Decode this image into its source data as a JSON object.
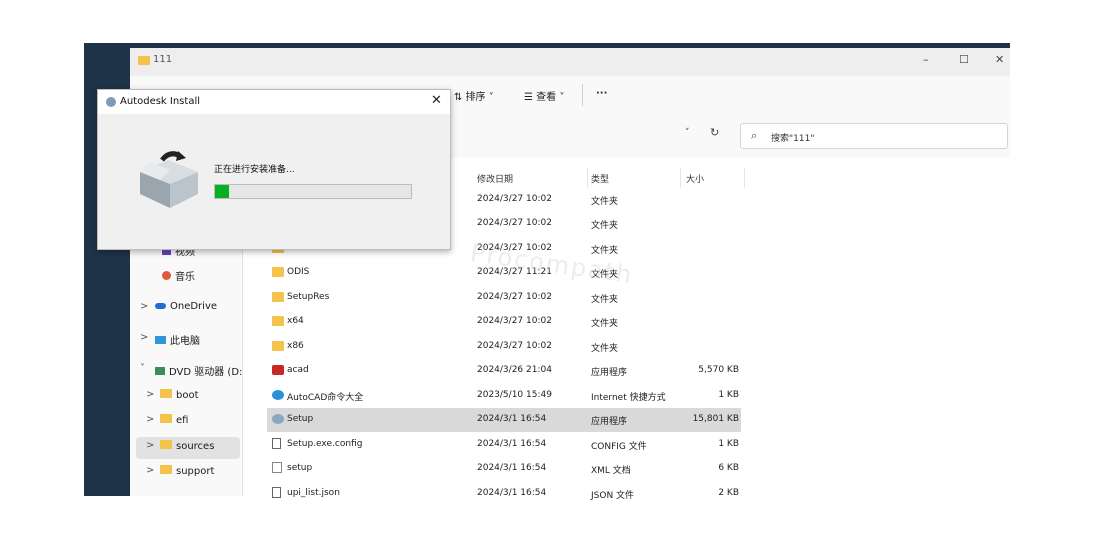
{
  "explorer": {
    "title": "111",
    "window_buttons": {
      "minimize": "–",
      "maximize": "☐",
      "close": "✕"
    },
    "toolbar": {
      "sort_label": "⇅ 排序 ˅",
      "view_label": "☰ 查看 ˅",
      "more_label": "···"
    },
    "address": {
      "chevron": "˅",
      "refresh": "↻"
    },
    "search": {
      "placeholder": "搜索\"111\""
    }
  },
  "sidebar": {
    "items": [
      {
        "label": "视频"
      },
      {
        "label": "音乐"
      },
      {
        "label": "OneDrive",
        "chevron": ">"
      },
      {
        "label": "此电脑",
        "chevron": ">"
      },
      {
        "label": "DVD 驱动器 (D:",
        "chevron": "˅"
      },
      {
        "label": "boot",
        "chevron": ">"
      },
      {
        "label": "efi",
        "chevron": ">"
      },
      {
        "label": "sources",
        "chevron": ">"
      },
      {
        "label": "support",
        "chevron": ">"
      }
    ]
  },
  "file_list": {
    "columns": {
      "modified": "修改日期",
      "type": "类型",
      "size": "大小"
    },
    "rows": [
      {
        "name": "",
        "modified": "2024/3/27 10:02",
        "type": "文件夹",
        "size": ""
      },
      {
        "name": "",
        "modified": "2024/3/27 10:02",
        "type": "文件夹",
        "size": ""
      },
      {
        "name": "",
        "modified": "2024/3/27 10:02",
        "type": "文件夹",
        "size": ""
      },
      {
        "name": "ODIS",
        "modified": "2024/3/27 11:21",
        "type": "文件夹",
        "size": ""
      },
      {
        "name": "SetupRes",
        "modified": "2024/3/27 10:02",
        "type": "文件夹",
        "size": ""
      },
      {
        "name": "x64",
        "modified": "2024/3/27 10:02",
        "type": "文件夹",
        "size": ""
      },
      {
        "name": "x86",
        "modified": "2024/3/27 10:02",
        "type": "文件夹",
        "size": ""
      },
      {
        "name": "acad",
        "modified": "2024/3/26 21:04",
        "type": "应用程序",
        "size": "5,570 KB"
      },
      {
        "name": "AutoCAD命令大全",
        "modified": "2023/5/10 15:49",
        "type": "Internet 快捷方式",
        "size": "1 KB"
      },
      {
        "name": "Setup",
        "modified": "2024/3/1 16:54",
        "type": "应用程序",
        "size": "15,801 KB"
      },
      {
        "name": "Setup.exe.config",
        "modified": "2024/3/1 16:54",
        "type": "CONFIG 文件",
        "size": "1 KB"
      },
      {
        "name": "setup",
        "modified": "2024/3/1 16:54",
        "type": "XML 文档",
        "size": "6 KB"
      },
      {
        "name": "upi_list.json",
        "modified": "2024/3/1 16:54",
        "type": "JSON 文件",
        "size": "2 KB"
      }
    ]
  },
  "dialog": {
    "title": "Autodesk Install",
    "close": "✕",
    "status": "正在进行安装准备...",
    "progress_fraction": 0.07
  },
  "watermark": {
    "text": "Procompath"
  }
}
